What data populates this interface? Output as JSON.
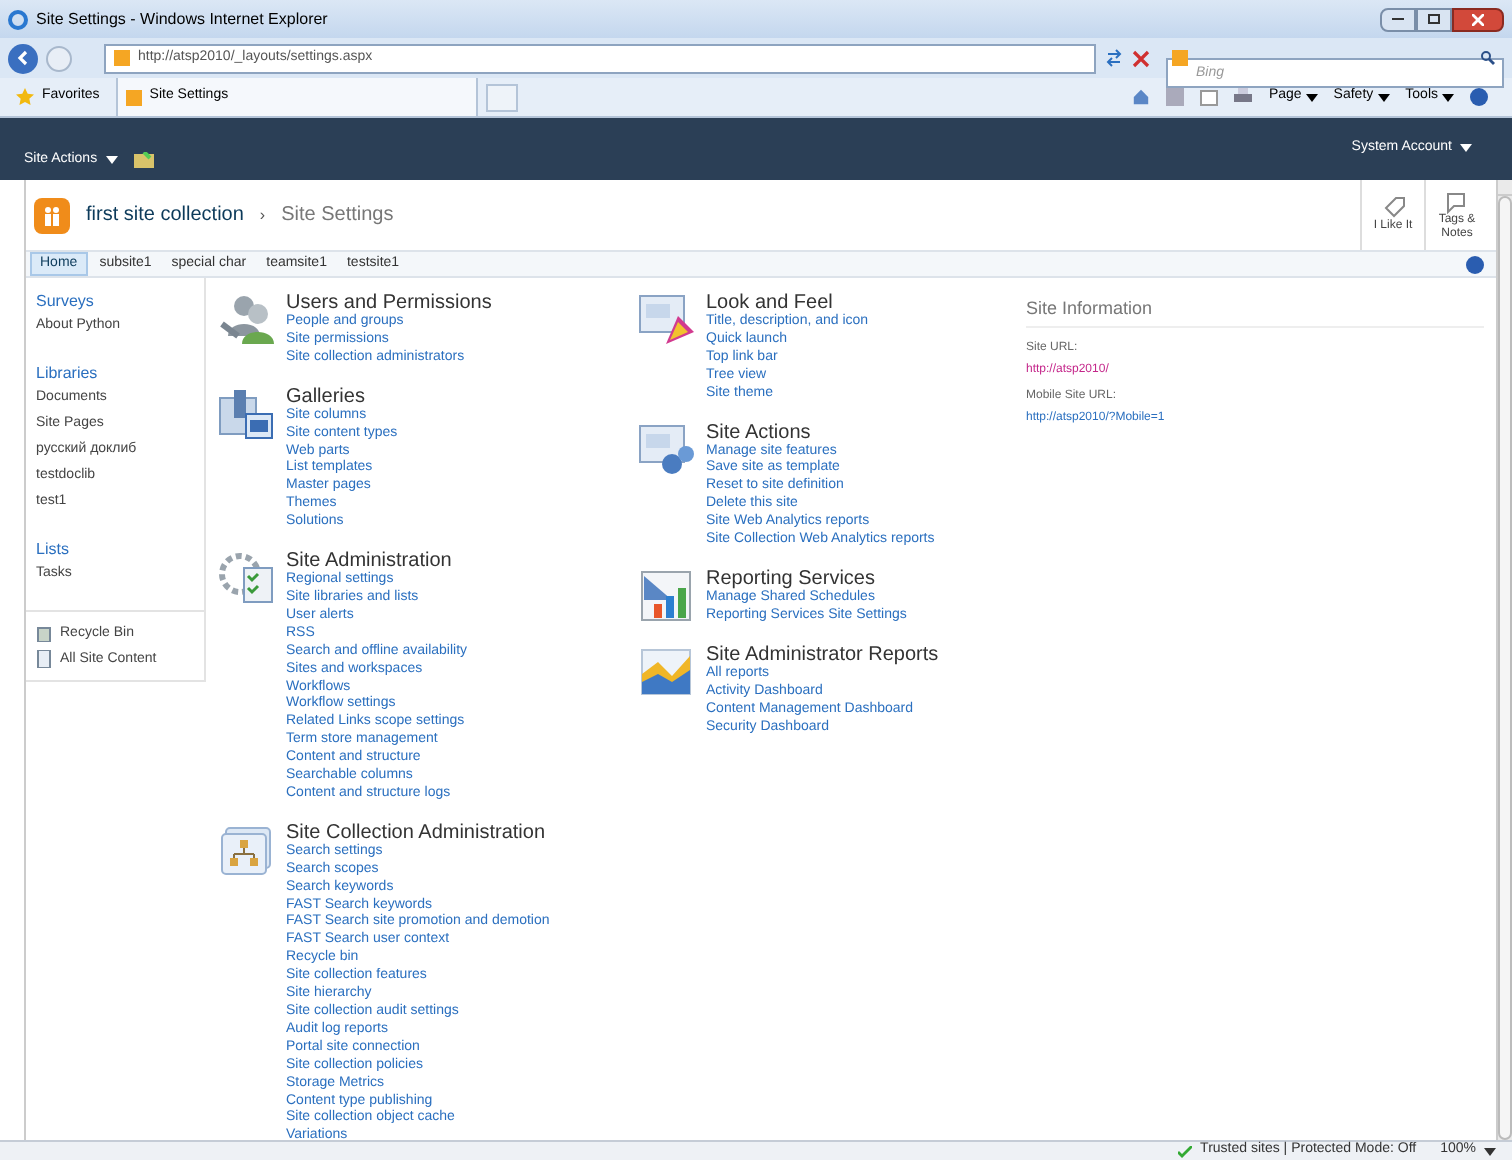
{
  "browser": {
    "title": "Site Settings - Windows Internet Explorer",
    "address": "http://atsp2010/_layouts/settings.aspx",
    "search_placeholder": "Bing",
    "favorites": "Favorites",
    "tab": "Site Settings",
    "commands": [
      "Page",
      "Safety",
      "Tools"
    ]
  },
  "ribbon": {
    "site_actions": "Site Actions",
    "account": "System Account"
  },
  "header": {
    "site": "first site collection",
    "separator": "›",
    "page": "Site Settings",
    "actions": [
      {
        "kind": "like",
        "label": "I Like It"
      },
      {
        "kind": "tags",
        "label": "Tags & Notes"
      }
    ]
  },
  "top_nav": [
    {
      "label": "Home",
      "selected": true
    },
    {
      "label": "subsite1",
      "selected": false
    },
    {
      "label": "special char",
      "selected": false
    },
    {
      "label": "teamsite1",
      "selected": false
    },
    {
      "label": "testsite1",
      "selected": false
    }
  ],
  "left_nav": [
    {
      "heading": "Surveys",
      "items": [
        "About Python"
      ]
    },
    {
      "heading": "Libraries",
      "items": [
        "Documents",
        "Site Pages",
        "русский доклиб",
        "testdoclib",
        "test1"
      ]
    },
    {
      "heading": "Lists",
      "items": [
        "Tasks"
      ]
    }
  ],
  "left_nav_footer": [
    {
      "kind": "recycle",
      "label": "Recycle Bin"
    },
    {
      "kind": "content",
      "label": "All Site Content"
    }
  ],
  "columns": [
    [
      {
        "kind": "users",
        "title": "Users and Permissions",
        "links": [
          "People and groups",
          "Site permissions",
          "Site collection administrators"
        ]
      },
      {
        "kind": "galleries",
        "title": "Galleries",
        "links": [
          "Site columns",
          "Site content types",
          "Web parts",
          "List templates",
          "Master pages",
          "Themes",
          "Solutions"
        ]
      },
      {
        "kind": "admin",
        "title": "Site Administration",
        "links": [
          "Regional settings",
          "Site libraries and lists",
          "User alerts",
          "RSS",
          "Search and offline availability",
          "Sites and workspaces",
          "Workflows",
          "Workflow settings",
          "Related Links scope settings",
          "Term store management",
          "Content and structure",
          "Searchable columns",
          "Content and structure logs"
        ]
      },
      {
        "kind": "collection",
        "title": "Site Collection Administration",
        "links": [
          "Search settings",
          "Search scopes",
          "Search keywords",
          "FAST Search keywords",
          "FAST Search site promotion and demotion",
          "FAST Search user context",
          "Recycle bin",
          "Site collection features",
          "Site hierarchy",
          "Site collection audit settings",
          "Audit log reports",
          "Portal site connection",
          "Site collection policies",
          "Storage Metrics",
          "Content type publishing",
          "Site collection object cache",
          "Variations"
        ]
      }
    ],
    [
      {
        "kind": "look",
        "title": "Look and Feel",
        "links": [
          "Title, description, and icon",
          "Quick launch",
          "Top link bar",
          "Tree view",
          "Site theme"
        ]
      },
      {
        "kind": "actions",
        "title": "Site Actions",
        "links": [
          "Manage site features",
          "Save site as template",
          "Reset to site definition",
          "Delete this site",
          "Site Web Analytics reports",
          "Site Collection Web Analytics reports"
        ]
      },
      {
        "kind": "reporting",
        "title": "Reporting Services",
        "links": [
          "Manage Shared Schedules",
          "Reporting Services Site Settings"
        ]
      },
      {
        "kind": "reports",
        "title": "Site Administrator Reports",
        "links": [
          "All reports",
          "Activity Dashboard",
          "Content Management Dashboard",
          "Security Dashboard"
        ]
      }
    ]
  ],
  "site_info": {
    "title": "Site Information",
    "fields": [
      {
        "label": "Site URL:",
        "value": "http://atsp2010/",
        "visited": true
      },
      {
        "label": "Mobile Site URL:",
        "value": "http://atsp2010/?Mobile=1",
        "visited": false
      }
    ]
  },
  "status_bar": {
    "zone": "Trusted sites | Protected Mode: Off",
    "zoom": "100%"
  }
}
